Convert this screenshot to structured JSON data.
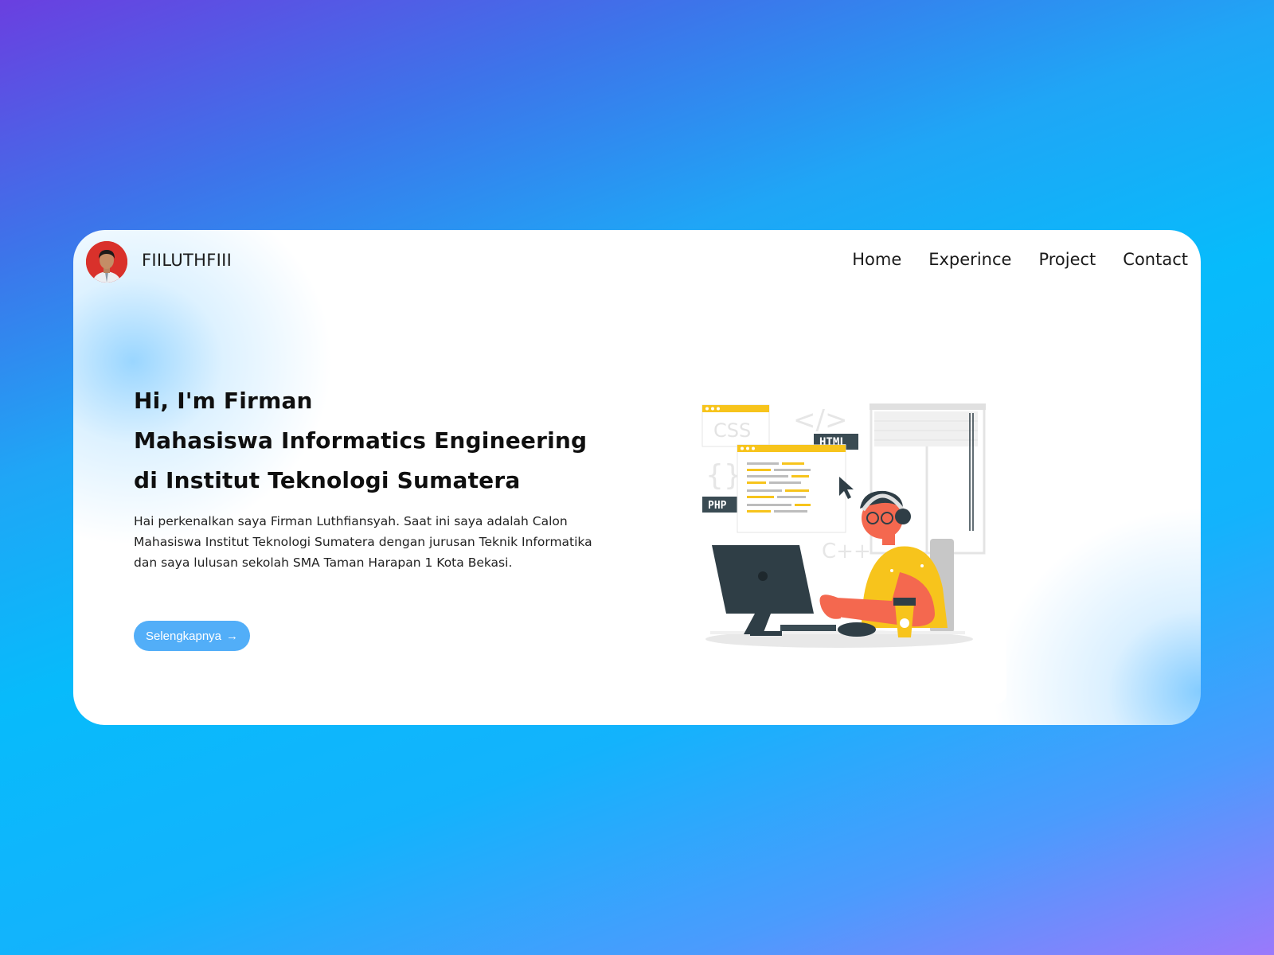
{
  "nav": {
    "brand": "FIILUTHFIII",
    "links": [
      "Home",
      "Experince",
      "Project",
      "Contact"
    ]
  },
  "hero": {
    "title_lines": [
      "Hi, I'm Firman",
      "Mahasiswa Informatics Engineering",
      "di Institut Teknologi Sumatera"
    ],
    "description": "Hai perkenalkan saya Firman Luthfiansyah. Saat ini saya adalah Calon Mahasiswa Institut Teknologi Sumatera dengan jurusan Teknik Informatika dan saya lulusan sekolah SMA Taman Harapan 1 Kota Bekasi.",
    "cta_label": "Selengkapnya",
    "cta_icon": "arrow-right-icon"
  },
  "illustration": {
    "labels": [
      "CSS",
      "HTML",
      "PHP",
      "C++",
      "</>",
      "{}"
    ]
  },
  "colors": {
    "accent": "#52aef8",
    "avatar_bg": "#d9312b",
    "illus_yellow": "#f7c41c",
    "illus_coral": "#f4684f",
    "illus_dark": "#2f3e46"
  }
}
